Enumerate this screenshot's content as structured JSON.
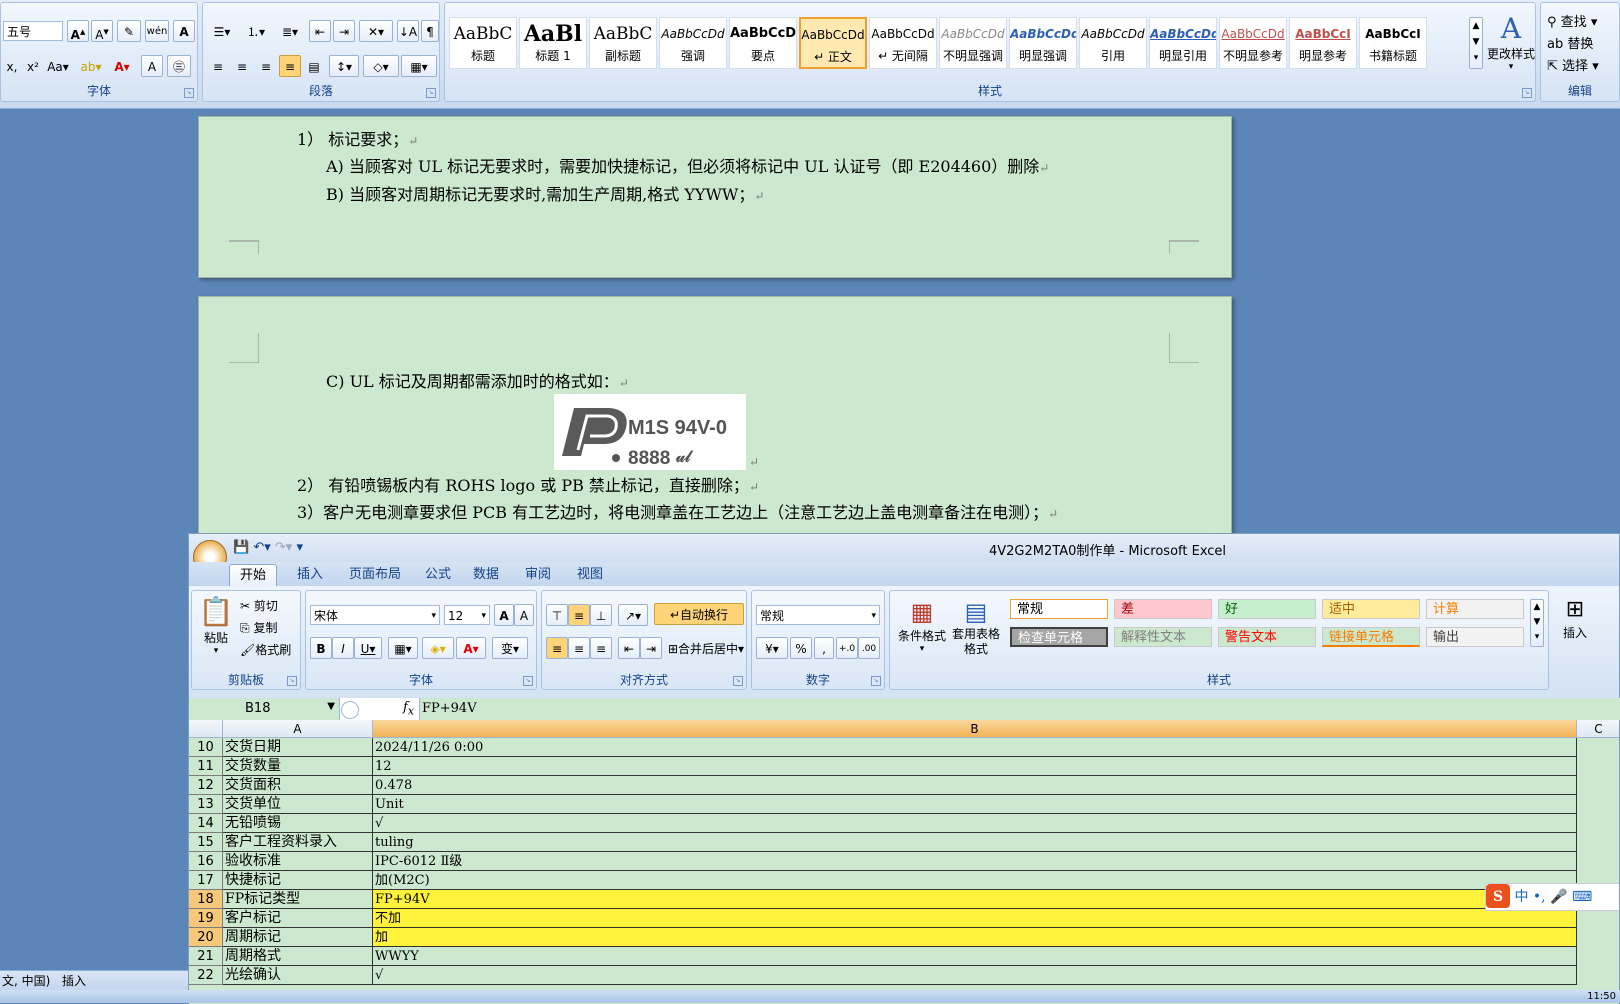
{
  "word": {
    "ribbon": {
      "font_group": {
        "label": "字体",
        "font_size": "五号"
      },
      "paragraph_group": {
        "label": "段落"
      },
      "styles_group": {
        "label": "样式",
        "styles": [
          {
            "preview": "AaBbC",
            "name": "标题"
          },
          {
            "preview": "AaBl",
            "name": "标题 1"
          },
          {
            "preview": "AaBbC",
            "name": "副标题"
          },
          {
            "preview": "AaBbCcDd",
            "name": "强调"
          },
          {
            "preview": "AaBbCcD",
            "name": "要点"
          },
          {
            "preview": "AaBbCcDd",
            "name": "↵ 正文"
          },
          {
            "preview": "AaBbCcDd",
            "name": "↵ 无间隔"
          },
          {
            "preview": "AaBbCcDd",
            "name": "不明显强调"
          },
          {
            "preview": "AaBbCcDd",
            "name": "明显强调"
          },
          {
            "preview": "AaBbCcDd",
            "name": "引用"
          },
          {
            "preview": "AaBbCcDd",
            "name": "明显引用"
          },
          {
            "preview": "AaBbCcDd",
            "name": "不明显参考"
          },
          {
            "preview": "AaBbCcI",
            "name": "明显参考"
          },
          {
            "preview": "AaBbCcI",
            "name": "书籍标题"
          }
        ],
        "change_styles": "更改样式"
      },
      "editing_group": {
        "label": "编辑",
        "find": "查找",
        "replace": "替换",
        "select": "选择"
      }
    },
    "page1": {
      "line1": "1） 标记要求；",
      "line2": "A)  当顾客对 UL 标记无要求时，需要加快捷标记，但必须将标记中 UL 认证号（即 E204460）删除",
      "line3": "B)  当顾客对周期标记无要求时,需加生产周期,格式 YYWW；"
    },
    "page2": {
      "line1": "C)  UL 标记及周期都需添加时的格式如：",
      "logo_text1": "M1S 94V-0",
      "logo_text2": "8888",
      "line2": "2） 有铅喷锡板内有 ROHS logo 或 PB 禁止标记，直接删除；",
      "line3": "3）客户无电测章要求但 PCB 有工艺边时，将电测章盖在工艺边上（注意工艺边上盖电测章备注在电测）；"
    },
    "status": {
      "lang": "文, 中国)",
      "mode": "插入"
    }
  },
  "excel": {
    "title": "4V2G2M2TA0制作单 - Microsoft Excel",
    "tabs": [
      "开始",
      "插入",
      "页面布局",
      "公式",
      "数据",
      "审阅",
      "视图"
    ],
    "clipboard": {
      "label": "剪贴板",
      "paste": "粘贴",
      "cut": "剪切",
      "copy": "复制",
      "format_painter": "格式刷"
    },
    "font": {
      "label": "字体",
      "name": "宋体",
      "size": "12"
    },
    "alignment": {
      "label": "对齐方式",
      "wrap": "自动换行",
      "merge": "合并后居中"
    },
    "number": {
      "label": "数字",
      "format": "常规"
    },
    "styles": {
      "label": "样式",
      "conditional": "条件格式",
      "table_format": "套用表格格式",
      "cells": [
        {
          "text": "常规",
          "bg": "#ffffff",
          "color": "#000000"
        },
        {
          "text": "差",
          "bg": "#ffc7ce",
          "color": "#9c0006"
        },
        {
          "text": "好",
          "bg": "#c6efce",
          "color": "#006100"
        },
        {
          "text": "适中",
          "bg": "#ffeb9c",
          "color": "#9c6500"
        },
        {
          "text": "计算",
          "bg": "#f2f2f2",
          "color": "#fa7d00"
        },
        {
          "text": "检查单元格",
          "bg": "#a5a5a5",
          "color": "#ffffff"
        },
        {
          "text": "解释性文本",
          "bg": "#cce8cf",
          "color": "#7f7f7f"
        },
        {
          "text": "警告文本",
          "bg": "#cce8cf",
          "color": "#ff0000"
        },
        {
          "text": "链接单元格",
          "bg": "#cce8cf",
          "color": "#fa7d00"
        },
        {
          "text": "输出",
          "bg": "#f2f2f2",
          "color": "#3f3f3f"
        }
      ],
      "insert": "插入"
    },
    "name_box": "B18",
    "formula": "FP+94V",
    "columns": [
      "A",
      "B",
      "C"
    ],
    "rows": [
      {
        "num": "10",
        "a": "交货日期",
        "b": "2024/11/26 0:00",
        "hl": false
      },
      {
        "num": "11",
        "a": "交货数量",
        "b": "12",
        "hl": false
      },
      {
        "num": "12",
        "a": "交货面积",
        "b": "0.478",
        "hl": false
      },
      {
        "num": "13",
        "a": "交货单位",
        "b": "Unit",
        "hl": false
      },
      {
        "num": "14",
        "a": "无铅喷锡",
        "b": "√",
        "hl": false
      },
      {
        "num": "15",
        "a": "客户工程资料录入",
        "b": "tuling",
        "hl": false
      },
      {
        "num": "16",
        "a": "验收标准",
        "b": "IPC-6012 Ⅱ级",
        "hl": false
      },
      {
        "num": "17",
        "a": "快捷标记",
        "b": "加(M2C)",
        "hl": false
      },
      {
        "num": "18",
        "a": "FP标记类型",
        "b": "FP+94V",
        "hl": true
      },
      {
        "num": "19",
        "a": "客户标记",
        "b": "不加",
        "hl": true
      },
      {
        "num": "20",
        "a": "周期标记",
        "b": "加",
        "hl": true
      },
      {
        "num": "21",
        "a": "周期格式",
        "b": "WWYY",
        "hl": false
      },
      {
        "num": "22",
        "a": "光绘确认",
        "b": "√",
        "hl": false
      }
    ],
    "ime": {
      "lang": "中"
    }
  },
  "taskbar": {
    "clock": "11:50"
  }
}
